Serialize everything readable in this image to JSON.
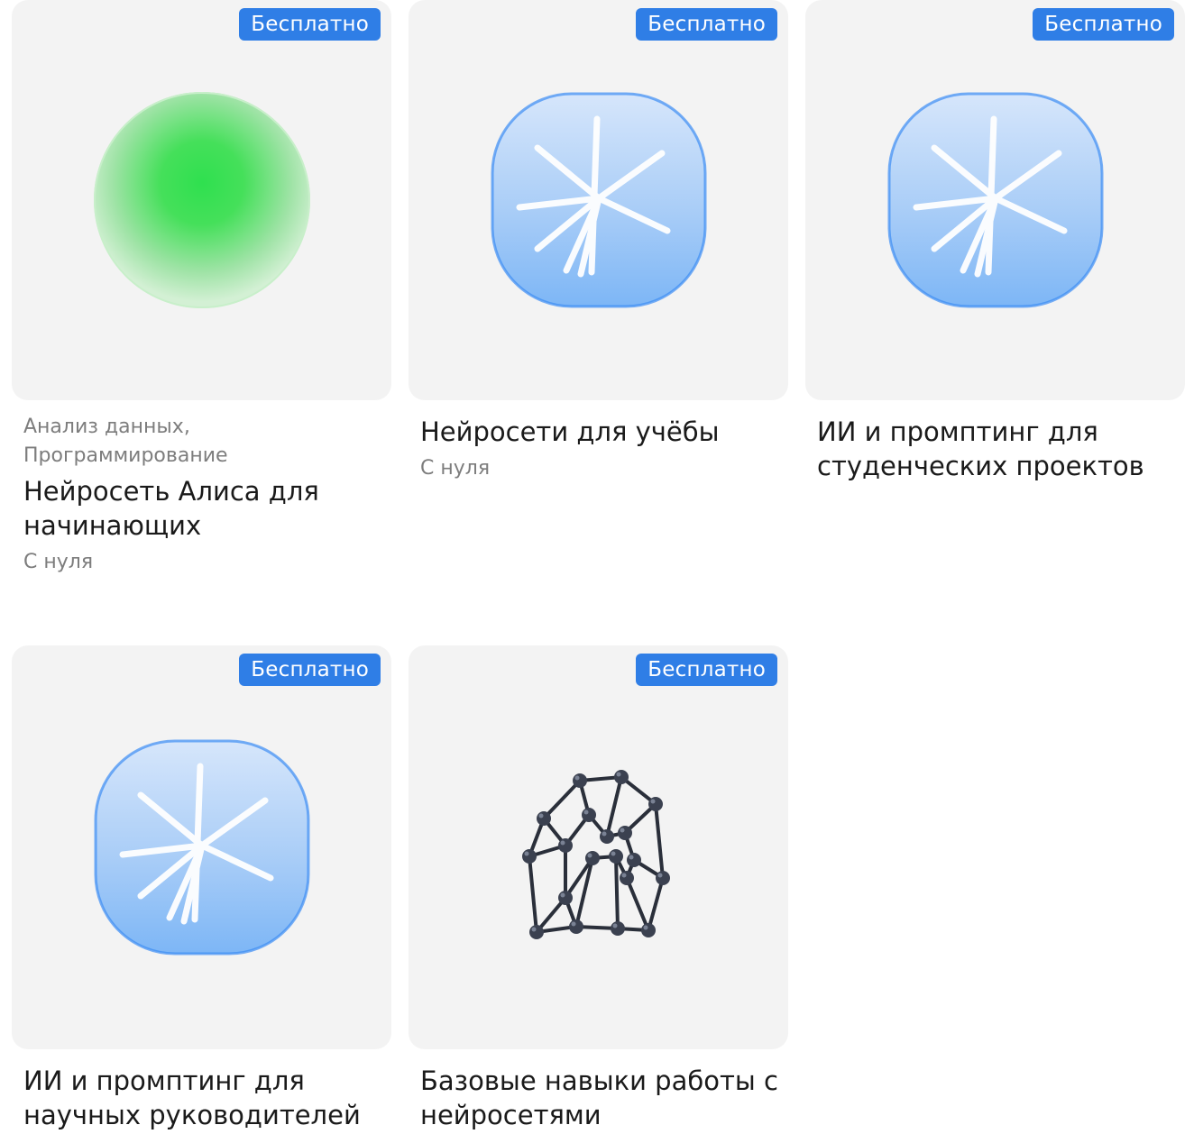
{
  "courses": [
    {
      "badge": "Бесплатно",
      "tags": "Анализ данных,\nПрограммирование",
      "title": "Нейросеть Алиса для начинающих",
      "level": "С нуля",
      "image": "green-orb-icon"
    },
    {
      "badge": "Бесплатно",
      "title": "Нейросети для учёбы",
      "level": "С нуля",
      "image": "blue-sparkle-icon"
    },
    {
      "badge": "Бесплатно",
      "title": "ИИ и промптинг для студенческих проектов",
      "image": "blue-sparkle-icon"
    },
    {
      "badge": "Бесплатно",
      "title": "ИИ и промптинг для научных руководителей",
      "image": "blue-sparkle-icon"
    },
    {
      "badge": "Бесплатно",
      "title": "Базовые навыки работы с нейросетями",
      "image": "molecule-network-icon"
    }
  ],
  "colors": {
    "badge": "#2f7ee6",
    "card_bg": "#f3f3f3",
    "muted_text": "#7d7d7d"
  }
}
